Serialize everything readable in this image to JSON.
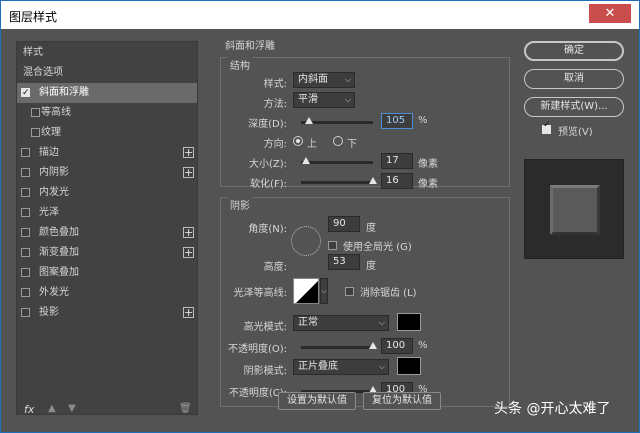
{
  "window": {
    "title": "图层样式",
    "close_glyph": "✕"
  },
  "left_panel": {
    "items": [
      {
        "label": "样式",
        "checkbox": false,
        "checked": false,
        "selected": false,
        "sub": false,
        "plus": false
      },
      {
        "label": "混合选项",
        "checkbox": false,
        "checked": false,
        "selected": false,
        "sub": false,
        "plus": false
      },
      {
        "label": "斜面和浮雕",
        "checkbox": true,
        "checked": true,
        "selected": true,
        "sub": false,
        "plus": false
      },
      {
        "label": "等高线",
        "checkbox": true,
        "checked": false,
        "selected": false,
        "sub": true,
        "plus": false
      },
      {
        "label": "纹理",
        "checkbox": true,
        "checked": false,
        "selected": false,
        "sub": true,
        "plus": false
      },
      {
        "label": "描边",
        "checkbox": true,
        "checked": false,
        "selected": false,
        "sub": false,
        "plus": true
      },
      {
        "label": "内阴影",
        "checkbox": true,
        "checked": false,
        "selected": false,
        "sub": false,
        "plus": true
      },
      {
        "label": "内发光",
        "checkbox": true,
        "checked": false,
        "selected": false,
        "sub": false,
        "plus": false
      },
      {
        "label": "光泽",
        "checkbox": true,
        "checked": false,
        "selected": false,
        "sub": false,
        "plus": false
      },
      {
        "label": "颜色叠加",
        "checkbox": true,
        "checked": false,
        "selected": false,
        "sub": false,
        "plus": true
      },
      {
        "label": "渐变叠加",
        "checkbox": true,
        "checked": false,
        "selected": false,
        "sub": false,
        "plus": true
      },
      {
        "label": "图案叠加",
        "checkbox": true,
        "checked": false,
        "selected": false,
        "sub": false,
        "plus": false
      },
      {
        "label": "外发光",
        "checkbox": true,
        "checked": false,
        "selected": false,
        "sub": false,
        "plus": false
      },
      {
        "label": "投影",
        "checkbox": true,
        "checked": false,
        "selected": false,
        "sub": false,
        "plus": true
      }
    ],
    "footer": {
      "fx": "fx",
      "up": "▲",
      "down": "▼",
      "trash": "🗑"
    }
  },
  "bevel": {
    "section_title": "斜面和浮雕",
    "structure": {
      "caption": "结构",
      "style_label": "样式:",
      "style_value": "内斜面",
      "technique_label": "方法:",
      "technique_value": "平滑",
      "depth_label": "深度(D):",
      "depth_value": "105",
      "depth_unit": "%",
      "depth_level": 0.105,
      "direction_label": "方向:",
      "dir_up": "上",
      "dir_down": "下",
      "size_label": "大小(Z):",
      "size_value": "17",
      "size_unit": "像素",
      "size_level": 0.068,
      "soften_label": "软化(F):",
      "soften_value": "16",
      "soften_unit": "像素",
      "soften_level": 1.0
    },
    "shading": {
      "caption": "阴影",
      "angle_label": "角度(N):",
      "angle_value": "90",
      "angle_unit": "度",
      "global_light_label": "使用全局光 (G)",
      "altitude_label": "高度:",
      "altitude_value": "53",
      "altitude_unit": "度",
      "gloss_contour_label": "光泽等高线:",
      "anti_alias_label": "消除锯齿 (L)",
      "highlight_mode_label": "高光模式:",
      "highlight_mode_value": "正常",
      "highlight_color": "#000000",
      "highlight_opacity_label": "不透明度(O):",
      "highlight_opacity_value": "100",
      "highlight_opacity_unit": "%",
      "highlight_opacity_level": 1.0,
      "shadow_mode_label": "阴影模式:",
      "shadow_mode_value": "正片叠底",
      "shadow_color": "#000000",
      "shadow_opacity_label": "不透明度(C):",
      "shadow_opacity_value": "100",
      "shadow_opacity_unit": "%",
      "shadow_opacity_level": 1.0
    },
    "make_default": "设置为默认值",
    "reset_default": "复位为默认值"
  },
  "right_panel": {
    "ok": "确定",
    "cancel": "取消",
    "new_style": "新建样式(W)...",
    "preview_label": "预览(V)",
    "preview_checked": true
  },
  "watermark": "头条 @开心太难了"
}
